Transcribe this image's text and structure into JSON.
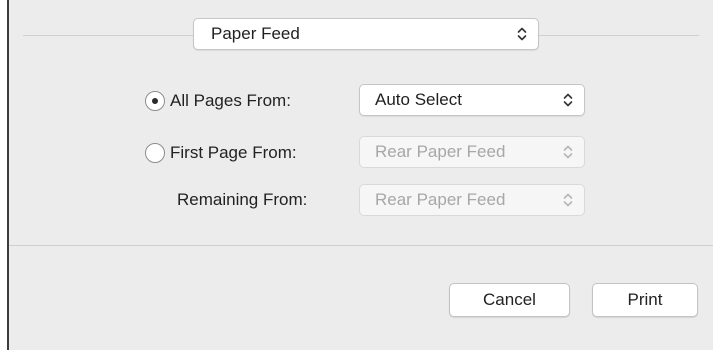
{
  "header": {
    "panel_select": {
      "value": "Paper Feed",
      "icon": "chevron-updown-icon"
    }
  },
  "paper_feed": {
    "all_pages": {
      "label": "All Pages From:",
      "selected": true,
      "source": "Auto Select",
      "source_enabled": true
    },
    "first_page": {
      "label": "First Page From:",
      "selected": false,
      "source": "Rear Paper Feed",
      "source_enabled": false
    },
    "remaining": {
      "label": "Remaining From:",
      "source": "Rear Paper Feed",
      "source_enabled": false
    }
  },
  "footer": {
    "cancel_label": "Cancel",
    "print_label": "Print"
  },
  "colors": {
    "dialog_background": "#ececec",
    "control_background": "#ffffff",
    "disabled_text": "#a7a7a7"
  }
}
